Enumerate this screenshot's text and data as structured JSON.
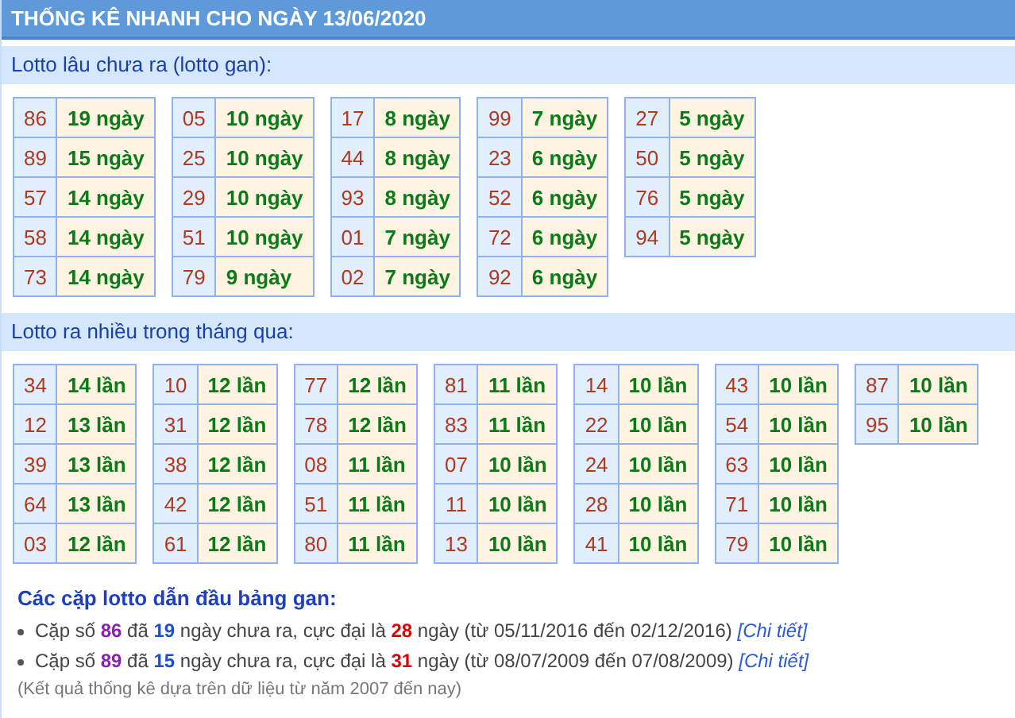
{
  "title": "THỐNG KÊ NHANH CHO NGÀY 13/06/2020",
  "sections": [
    {
      "heading": "Lotto lâu chưa ra (lotto gan):",
      "groups": [
        [
          [
            "86",
            "19 ngày"
          ],
          [
            "89",
            "15 ngày"
          ],
          [
            "57",
            "14 ngày"
          ],
          [
            "58",
            "14 ngày"
          ],
          [
            "73",
            "14 ngày"
          ]
        ],
        [
          [
            "05",
            "10 ngày"
          ],
          [
            "25",
            "10 ngày"
          ],
          [
            "29",
            "10 ngày"
          ],
          [
            "51",
            "10 ngày"
          ],
          [
            "79",
            "9 ngày"
          ]
        ],
        [
          [
            "17",
            "8 ngày"
          ],
          [
            "44",
            "8 ngày"
          ],
          [
            "93",
            "8 ngày"
          ],
          [
            "01",
            "7 ngày"
          ],
          [
            "02",
            "7 ngày"
          ]
        ],
        [
          [
            "99",
            "7 ngày"
          ],
          [
            "23",
            "6 ngày"
          ],
          [
            "52",
            "6 ngày"
          ],
          [
            "72",
            "6 ngày"
          ],
          [
            "92",
            "6 ngày"
          ]
        ],
        [
          [
            "27",
            "5 ngày"
          ],
          [
            "50",
            "5 ngày"
          ],
          [
            "76",
            "5 ngày"
          ],
          [
            "94",
            "5 ngày"
          ]
        ]
      ]
    },
    {
      "heading": "Lotto ra nhiều trong tháng qua:",
      "groups": [
        [
          [
            "34",
            "14 lần"
          ],
          [
            "12",
            "13 lần"
          ],
          [
            "39",
            "13 lần"
          ],
          [
            "64",
            "13 lần"
          ],
          [
            "03",
            "12 lần"
          ]
        ],
        [
          [
            "10",
            "12 lần"
          ],
          [
            "31",
            "12 lần"
          ],
          [
            "38",
            "12 lần"
          ],
          [
            "42",
            "12 lần"
          ],
          [
            "61",
            "12 lần"
          ]
        ],
        [
          [
            "77",
            "12 lần"
          ],
          [
            "78",
            "12 lần"
          ],
          [
            "08",
            "11 lần"
          ],
          [
            "51",
            "11 lần"
          ],
          [
            "80",
            "11 lần"
          ]
        ],
        [
          [
            "81",
            "11 lần"
          ],
          [
            "83",
            "11 lần"
          ],
          [
            "07",
            "10 lần"
          ],
          [
            "11",
            "10 lần"
          ],
          [
            "13",
            "10 lần"
          ]
        ],
        [
          [
            "14",
            "10 lần"
          ],
          [
            "22",
            "10 lần"
          ],
          [
            "24",
            "10 lần"
          ],
          [
            "28",
            "10 lần"
          ],
          [
            "41",
            "10 lần"
          ]
        ],
        [
          [
            "43",
            "10 lần"
          ],
          [
            "54",
            "10 lần"
          ],
          [
            "63",
            "10 lần"
          ],
          [
            "71",
            "10 lần"
          ],
          [
            "79",
            "10 lần"
          ]
        ],
        [
          [
            "87",
            "10 lần"
          ],
          [
            "95",
            "10 lần"
          ]
        ]
      ]
    }
  ],
  "summary": {
    "heading": "Các cặp lotto dẫn đầu bảng gan:",
    "items": [
      [
        {
          "kind": "plain",
          "text": "Cặp số "
        },
        {
          "kind": "pair",
          "text": "86"
        },
        {
          "kind": "plain",
          "text": " đã "
        },
        {
          "kind": "days",
          "text": "19"
        },
        {
          "kind": "plain",
          "text": " ngày chưa ra, cực đại là "
        },
        {
          "kind": "max",
          "text": "28"
        },
        {
          "kind": "plain",
          "text": " ngày (từ 05/11/2016 đến 02/12/2016) "
        },
        {
          "kind": "link",
          "text": "[Chi tiết]"
        }
      ],
      [
        {
          "kind": "plain",
          "text": "Cặp số "
        },
        {
          "kind": "pair",
          "text": "89"
        },
        {
          "kind": "plain",
          "text": " đã "
        },
        {
          "kind": "days",
          "text": "15"
        },
        {
          "kind": "plain",
          "text": " ngày chưa ra, cực đại là "
        },
        {
          "kind": "max",
          "text": "31"
        },
        {
          "kind": "plain",
          "text": " ngày (từ 08/07/2009 đến 07/08/2009) "
        },
        {
          "kind": "link",
          "text": "[Chi tiết]"
        }
      ]
    ],
    "note": "(Kết quả thống kê dựa trên dữ liệu từ năm 2007 đến nay)"
  }
}
